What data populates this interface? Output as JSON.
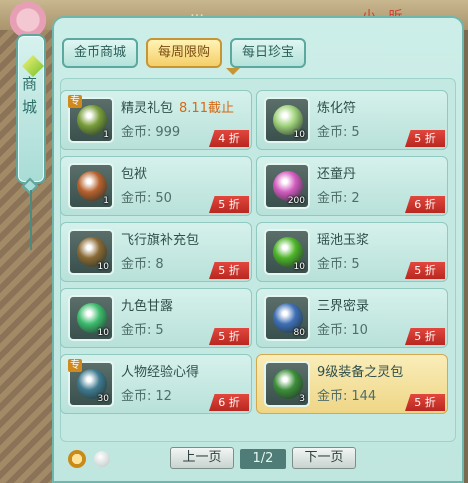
{
  "background": {
    "top_text": "…",
    "top_red_text": "小 昕"
  },
  "side_tab": {
    "label": "商城",
    "icon": "gem-icon"
  },
  "tabs": [
    {
      "label": "金币商城",
      "active": false
    },
    {
      "label": "每周限购",
      "active": true
    },
    {
      "label": "每日珍宝",
      "active": false
    }
  ],
  "price_prefix": "金币:",
  "items": [
    {
      "name": "精灵礼包",
      "deadline": "8.11截止",
      "price": "999",
      "qty": "1",
      "discount": "4 折",
      "badge": "专",
      "icon": "gift-bag-icon",
      "selected": false,
      "color": "#7a9e3a"
    },
    {
      "name": "炼化符",
      "deadline": "",
      "price": "5",
      "qty": "10",
      "discount": "5 折",
      "badge": "",
      "icon": "talisman-icon",
      "selected": false,
      "color": "#9fd27a"
    },
    {
      "name": "包袱",
      "deadline": "",
      "price": "50",
      "qty": "1",
      "discount": "5 折",
      "badge": "",
      "icon": "bag-icon",
      "selected": false,
      "color": "#b8622e"
    },
    {
      "name": "还童丹",
      "deadline": "",
      "price": "2",
      "qty": "200",
      "discount": "6 折",
      "badge": "",
      "icon": "pill-icon",
      "selected": false,
      "color": "#d35bbf"
    },
    {
      "name": "飞行旗补充包",
      "deadline": "",
      "price": "8",
      "qty": "10",
      "discount": "5 折",
      "badge": "",
      "icon": "flag-pack-icon",
      "selected": false,
      "color": "#8a6a34"
    },
    {
      "name": "瑶池玉浆",
      "deadline": "",
      "price": "5",
      "qty": "10",
      "discount": "5 折",
      "badge": "",
      "icon": "jade-potion-icon",
      "selected": false,
      "color": "#4fb52a"
    },
    {
      "name": "九色甘露",
      "deadline": "",
      "price": "5",
      "qty": "10",
      "discount": "5 折",
      "badge": "",
      "icon": "dew-gem-icon",
      "selected": false,
      "color": "#3dbd6e"
    },
    {
      "name": "三界密录",
      "deadline": "",
      "price": "10",
      "qty": "80",
      "discount": "5 折",
      "badge": "",
      "icon": "book-icon",
      "selected": false,
      "color": "#3e6fb6"
    },
    {
      "name": "人物经验心得",
      "deadline": "",
      "price": "12",
      "qty": "30",
      "discount": "6 折",
      "badge": "专",
      "icon": "manual-icon",
      "selected": false,
      "color": "#3f7a90"
    },
    {
      "name": "9级装备之灵包",
      "deadline": "",
      "price": "144",
      "qty": "3",
      "discount": "5 折",
      "badge": "",
      "icon": "equipment-bag-icon",
      "selected": true,
      "color": "#3d8f3a"
    }
  ],
  "pager": {
    "prev": "上一页",
    "page": "1/2",
    "next": "下一页"
  },
  "footer_icons": [
    "magnifier-icon",
    "orb-icon"
  ]
}
